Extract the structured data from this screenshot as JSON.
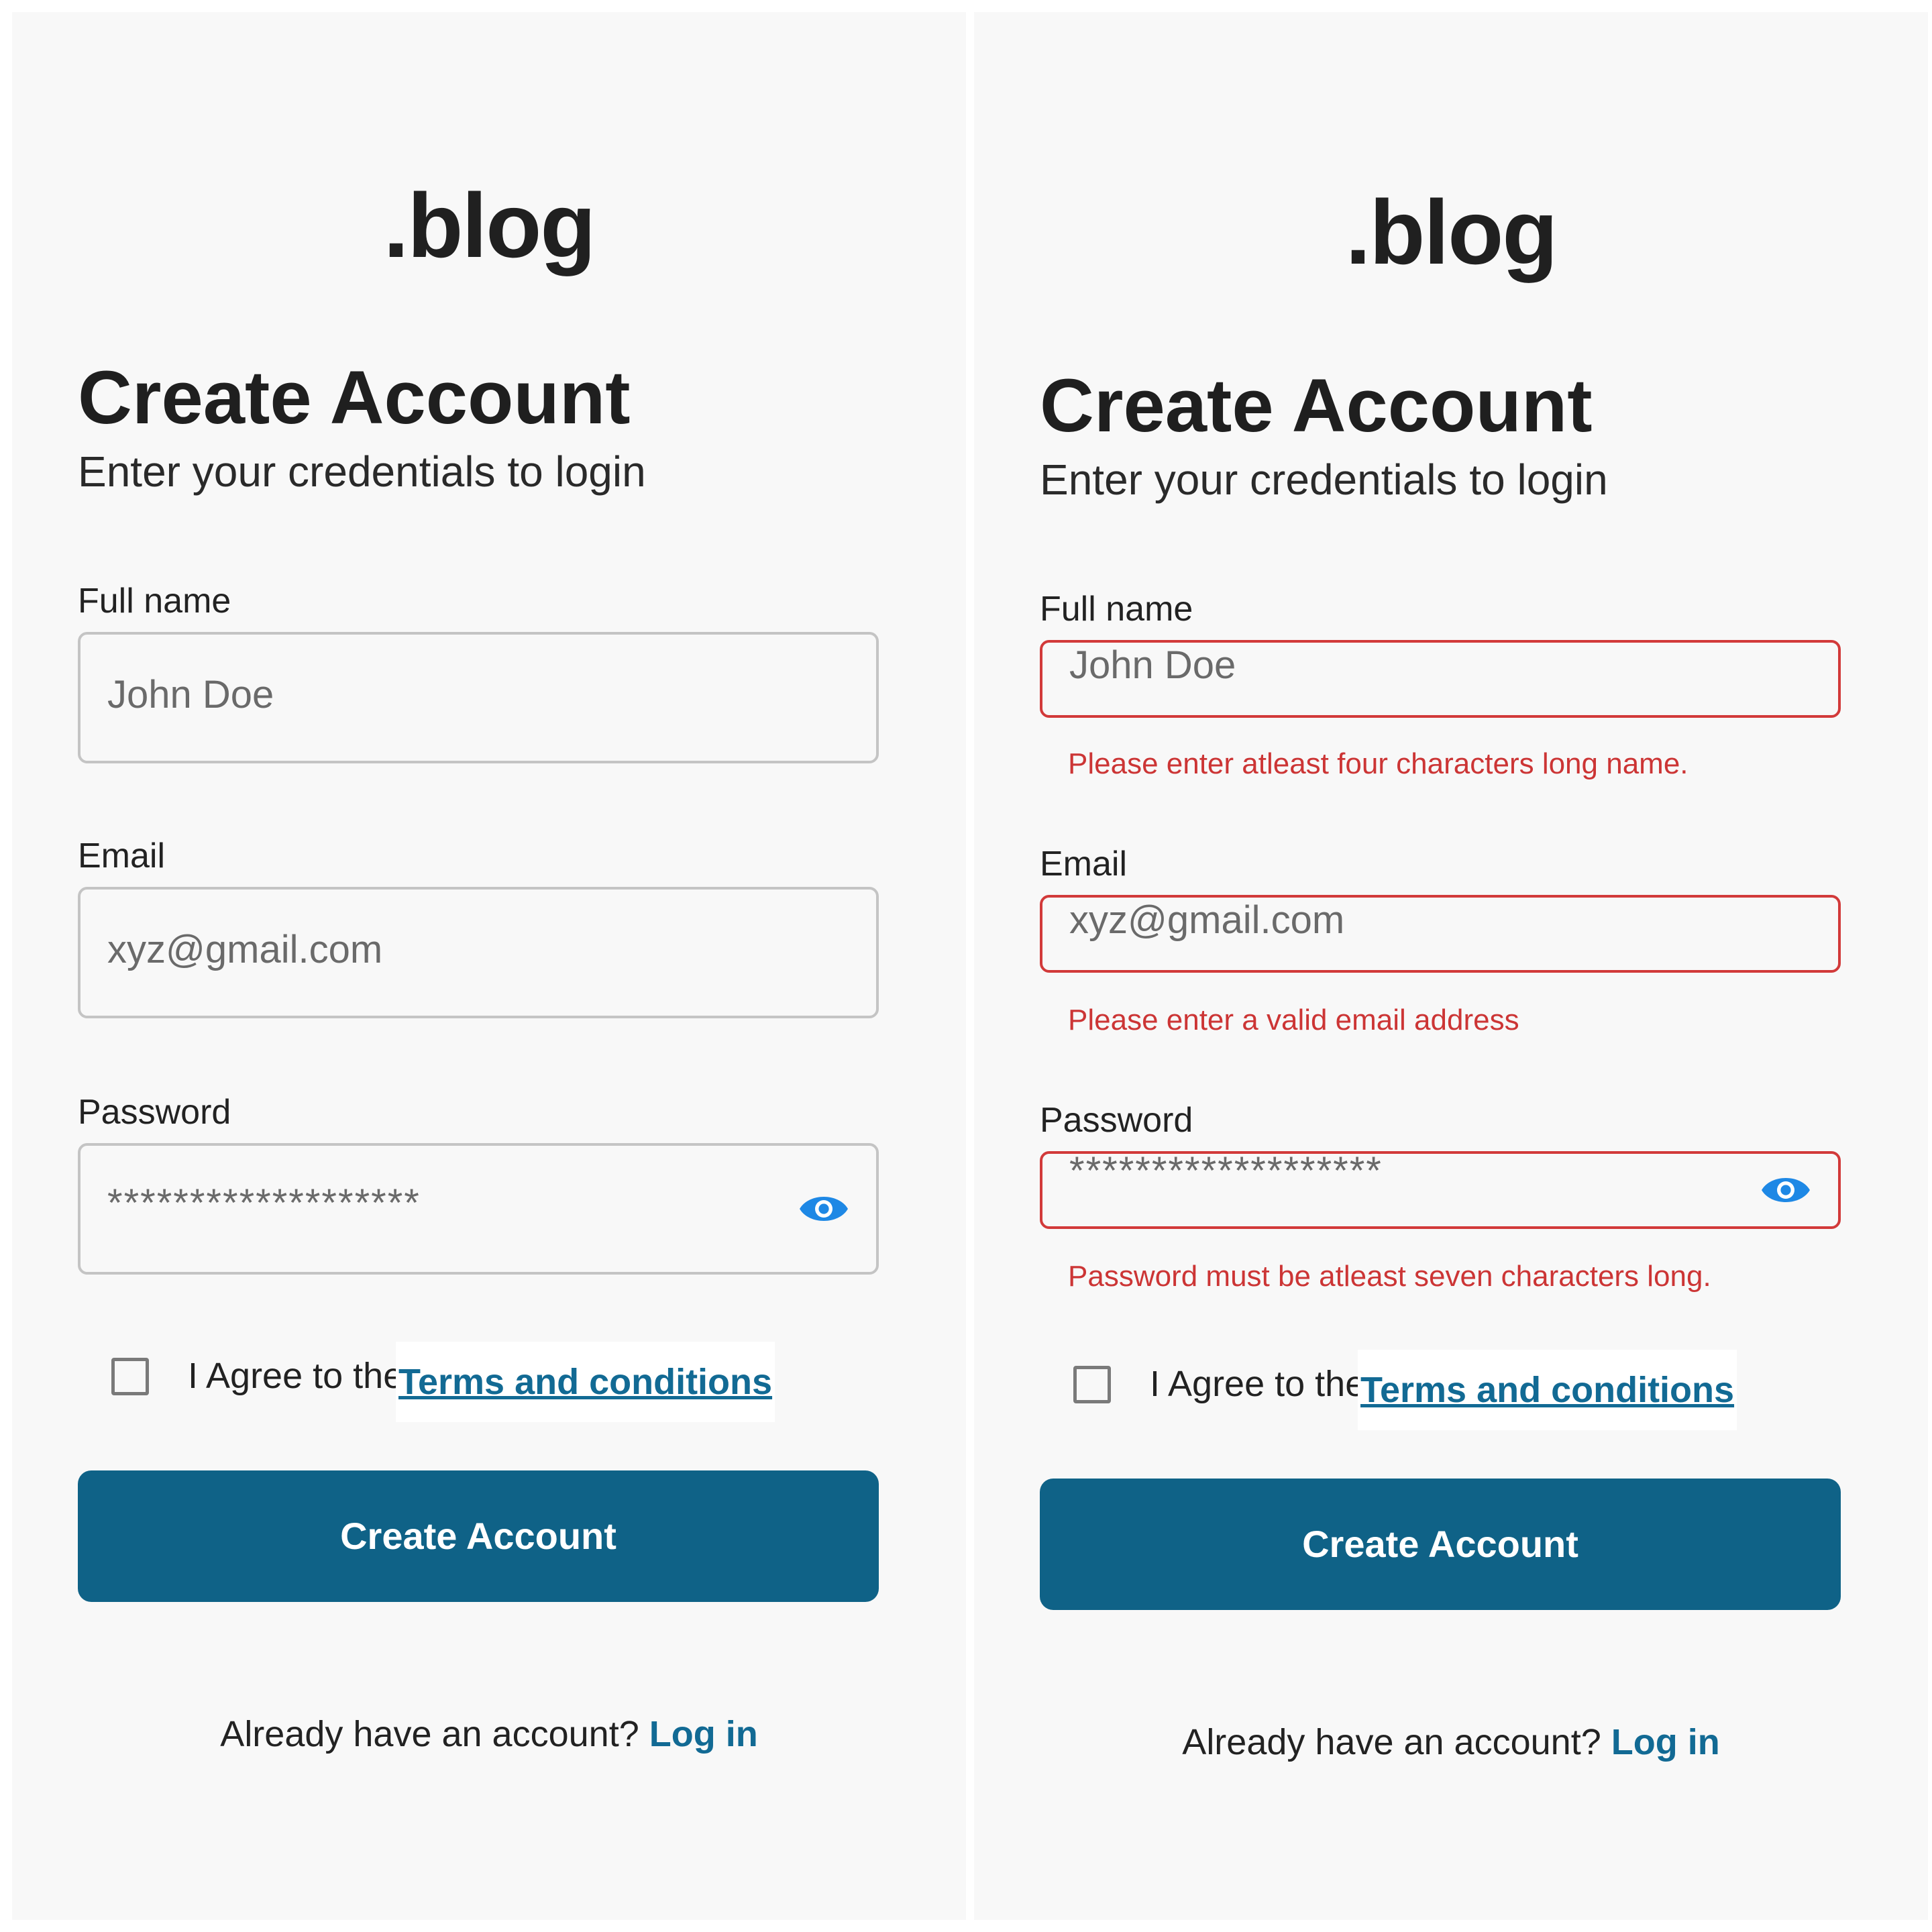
{
  "brand": {
    "logo": ".blog"
  },
  "page": {
    "title": "Create Account",
    "subtitle": "Enter your credentials to login"
  },
  "form": {
    "full_name": {
      "label": "Full name",
      "placeholder": "John Doe"
    },
    "email": {
      "label": "Email",
      "placeholder": "xyz@gmail.com"
    },
    "password": {
      "label": "Password",
      "value": "*******************"
    },
    "agree_text": "I Agree to the",
    "terms_link": "Terms and conditions",
    "submit_label": "Create Account"
  },
  "footer": {
    "prompt": "Already have an account?",
    "login_link": "Log in"
  },
  "errors": {
    "full_name": "Please enter atleast four characters long name.",
    "email": "Please enter a valid email address",
    "password": "Password must be atleast seven characters long."
  },
  "colors": {
    "primary": "#0f6287",
    "link": "#126a94",
    "error": "#d23a3a",
    "eye_icon": "#1e88e5"
  }
}
